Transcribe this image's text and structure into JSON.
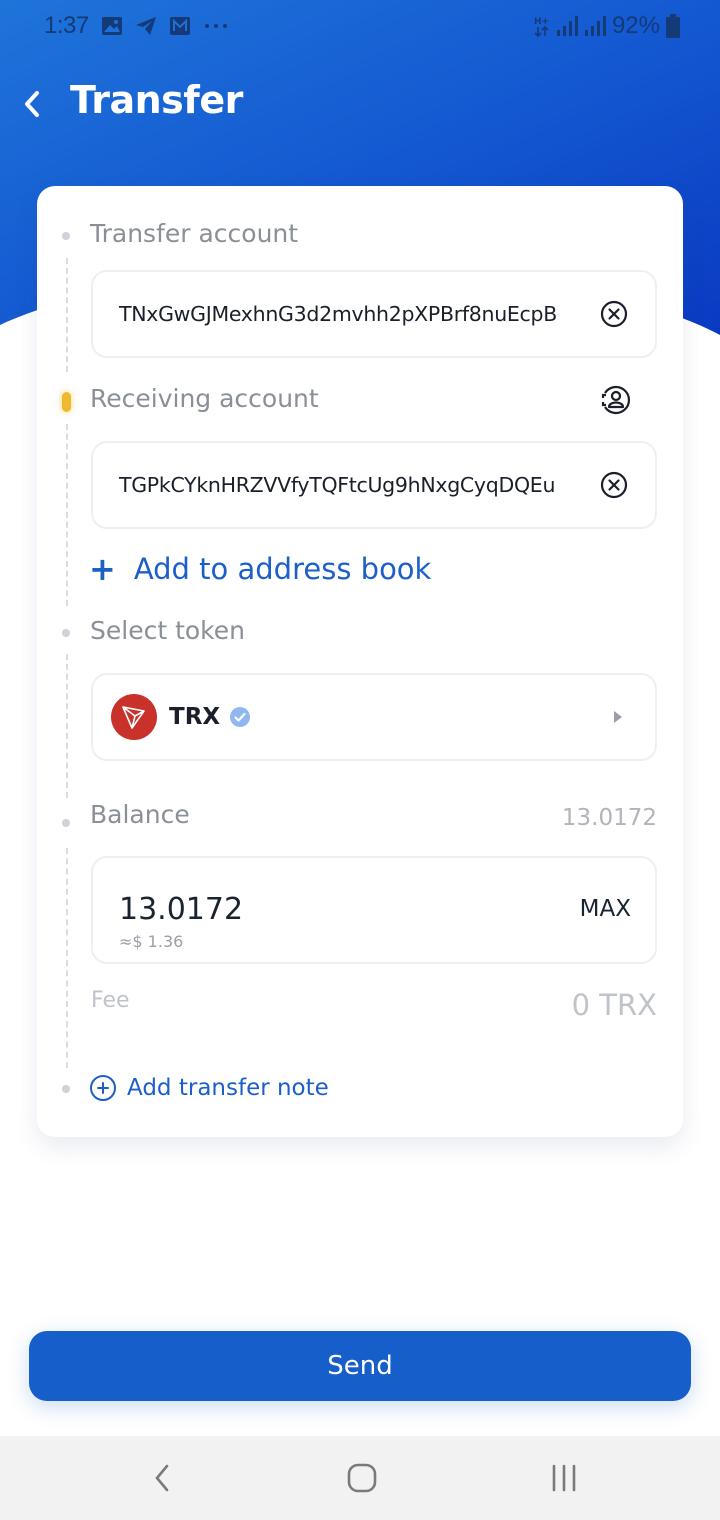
{
  "status_bar": {
    "time": "1:37",
    "notification_icons": [
      "gallery-icon",
      "telegram-icon",
      "mail-icon",
      "more-icon"
    ],
    "network_label": "H+",
    "battery": "92%"
  },
  "header": {
    "title": "Transfer",
    "back_icon": "chevron-left-icon"
  },
  "form": {
    "transfer_account": {
      "label": "Transfer account",
      "value": "TNxGwGJMexhnG3d2mvhh2pXPBrf8nuEcpB"
    },
    "receiving_account": {
      "label": "Receiving account",
      "value": "TGPkCYknHRZVVfyTQFtcUg9hNxgCyqDQEu"
    },
    "add_to_address_book": {
      "icon": "+",
      "label": "Add to address book"
    },
    "select_token": {
      "label": "Select token",
      "symbol": "TRX",
      "verified": true
    },
    "balance": {
      "label": "Balance",
      "value": "13.0172"
    },
    "amount": {
      "value": "13.0172",
      "fiat": "≈$ 1.36",
      "max_label": "MAX"
    },
    "fee": {
      "label": "Fee",
      "value": "0 TRX"
    },
    "add_transfer_note": {
      "label": "Add transfer note"
    }
  },
  "actions": {
    "send_label": "Send"
  },
  "colors": {
    "primary": "#165ec9",
    "header_gradient_start": "#1e6fd9",
    "header_gradient_end": "#0b3fc4",
    "link": "#1d5fc9",
    "active_step": "#f0b92d",
    "token_logo": "#c8322a",
    "verified": "#8fb8f3"
  }
}
